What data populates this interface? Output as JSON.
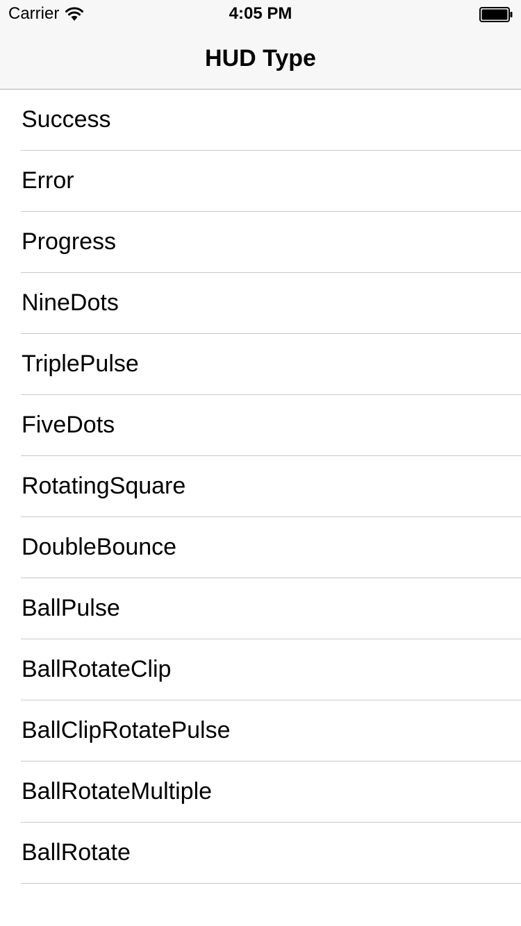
{
  "status_bar": {
    "carrier": "Carrier",
    "time": "4:05 PM",
    "wifi_icon": "wifi-icon",
    "battery_icon": "battery-icon"
  },
  "nav_bar": {
    "title": "HUD Type",
    "background": "#f7f7f7"
  },
  "list": {
    "separator_color": "#c8c7cc",
    "items": [
      {
        "label": "Success"
      },
      {
        "label": "Error"
      },
      {
        "label": "Progress"
      },
      {
        "label": "NineDots"
      },
      {
        "label": "TriplePulse"
      },
      {
        "label": "FiveDots"
      },
      {
        "label": "RotatingSquare"
      },
      {
        "label": "DoubleBounce"
      },
      {
        "label": "BallPulse"
      },
      {
        "label": "BallRotateClip"
      },
      {
        "label": "BallClipRotatePulse"
      },
      {
        "label": "BallRotateMultiple"
      },
      {
        "label": "BallRotate"
      }
    ]
  }
}
